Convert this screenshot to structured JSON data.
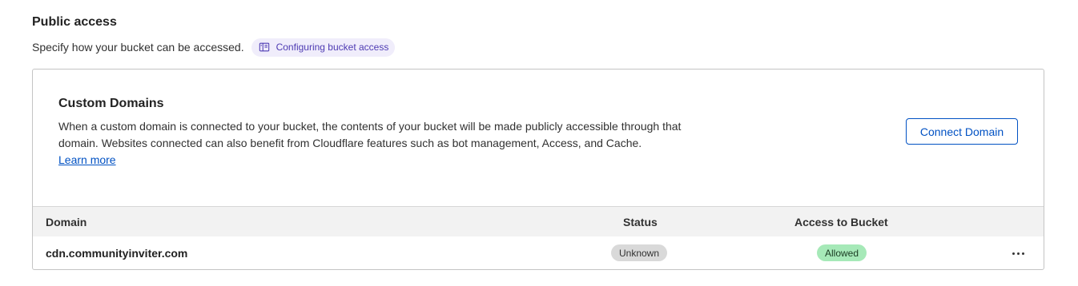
{
  "section": {
    "title": "Public access",
    "description": "Specify how your bucket can be accessed.",
    "doc_link": {
      "label": "Configuring bucket access",
      "icon": "book-icon"
    }
  },
  "custom_domains": {
    "title": "Custom Domains",
    "description": "When a custom domain is connected to your bucket, the contents of your bucket will be made publicly accessible through that domain. Websites connected can also benefit from Cloudflare features such as bot management, Access, and Cache.",
    "learn_more": "Learn more",
    "connect_button": "Connect Domain",
    "table": {
      "columns": [
        "Domain",
        "Status",
        "Access to Bucket"
      ],
      "rows": [
        {
          "domain": "cdn.communityinviter.com",
          "status": "Unknown",
          "access": "Allowed",
          "actions_icon": "more-horizontal-icon"
        }
      ]
    }
  },
  "colors": {
    "link": "#0051c3",
    "doc_pill_bg": "#f0edfb",
    "doc_pill_text": "#4e3bb3",
    "status_unknown_bg": "#d9d9d9",
    "access_allowed_bg": "#a6e9b8"
  }
}
